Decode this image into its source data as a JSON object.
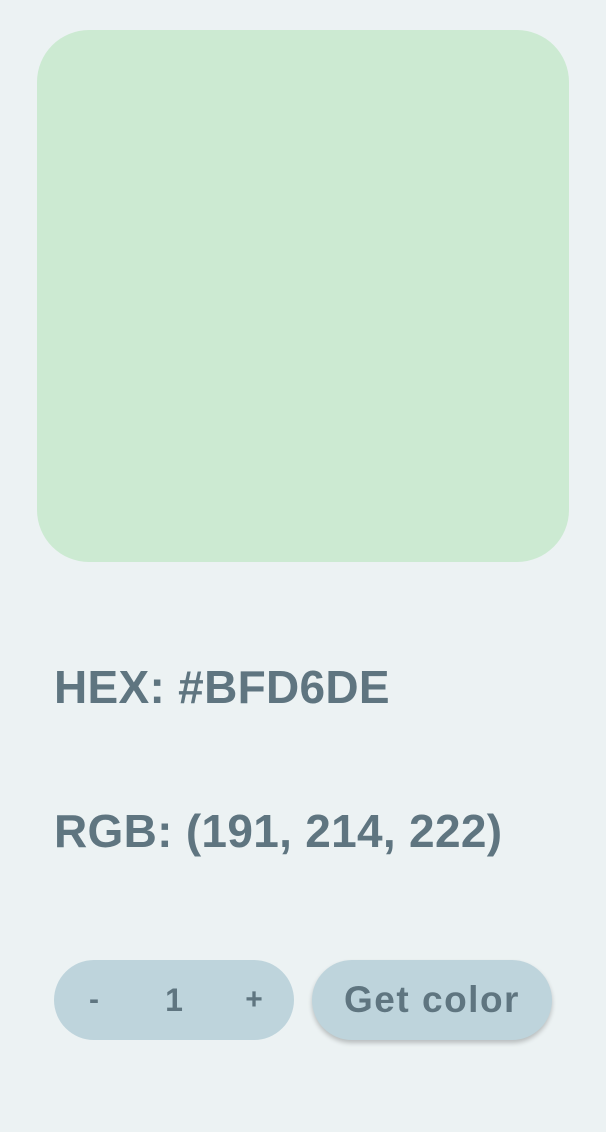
{
  "swatch": {
    "color": "#CCEAD2"
  },
  "info": {
    "hex_text": "HEX: #BFD6DE",
    "rgb_text": "RGB: (191, 214, 222)"
  },
  "stepper": {
    "decrement_label": "-",
    "value": "1",
    "increment_label": "+"
  },
  "actions": {
    "get_color_label": "Get color"
  }
}
